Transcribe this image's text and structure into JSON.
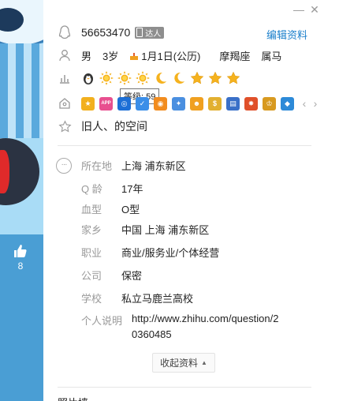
{
  "window": {
    "minimize_glyph": "—",
    "close_glyph": "✕"
  },
  "profile": {
    "qq_number": "56653470",
    "daren_badge": "达人",
    "edit_label": "编辑资料",
    "gender": "男",
    "age": "3岁",
    "birthday": "1月1日(公历)",
    "zodiac": "摩羯座",
    "chinese_zodiac": "属马",
    "level_tooltip": "等级: 59",
    "space_name": "旧人、的空间"
  },
  "level_icons": [
    "penguin-icon",
    "sun-icon",
    "sun-icon",
    "sun-icon",
    "moon-icon",
    "moon-icon",
    "star-icon",
    "star-icon",
    "star-icon"
  ],
  "vip_icons": [
    {
      "name": "vip-star-icon",
      "color": "#f2b01e",
      "glyph": "★"
    },
    {
      "name": "app-icon",
      "color": "#e84f8f",
      "glyph": "APP"
    },
    {
      "name": "vip-shield-icon",
      "color": "#1d6fd6",
      "glyph": "◎"
    },
    {
      "name": "vip-check-icon",
      "color": "#3b8ee8",
      "glyph": "✓"
    },
    {
      "name": "vip-orange-icon",
      "color": "#f28c1e",
      "glyph": "◉"
    },
    {
      "name": "vip-butterfly-icon",
      "color": "#4a8fe0",
      "glyph": "✦"
    },
    {
      "name": "vip-character-icon",
      "color": "#f0a020",
      "glyph": "☻"
    },
    {
      "name": "vip-coin-icon",
      "color": "#e2b030",
      "glyph": "$"
    },
    {
      "name": "vip-phone-icon",
      "color": "#3a70c8",
      "glyph": "▤"
    },
    {
      "name": "vip-fire-icon",
      "color": "#e0502a",
      "glyph": "✸"
    },
    {
      "name": "vip-king-icon",
      "color": "#d89a20",
      "glyph": "♔"
    },
    {
      "name": "vip-diamond-icon",
      "color": "#2d8ad8",
      "glyph": "◆"
    }
  ],
  "details": {
    "location_label": "所在地",
    "location_value": "上海 浦东新区",
    "qage_label": "Q 龄",
    "qage_value": "17年",
    "blood_label": "血型",
    "blood_value": "O型",
    "hometown_label": "家乡",
    "hometown_value": "中国 上海 浦东新区",
    "job_label": "职业",
    "job_value": "商业/服务业/个体经营",
    "company_label": "公司",
    "company_value": "保密",
    "school_label": "学校",
    "school_value": "私立马鹿兰高校",
    "bio_label": "个人说明",
    "bio_value_line1": "http://www.zhihu.com/question/2",
    "bio_value_line2": "0360485"
  },
  "collapse_label": "收起资料",
  "photo_wall_label": "照片墙",
  "like_count": "8",
  "colors": {
    "accent": "#1a7fcb",
    "label_gray": "#999999",
    "sidebar_blue": "#4a9ed4"
  }
}
